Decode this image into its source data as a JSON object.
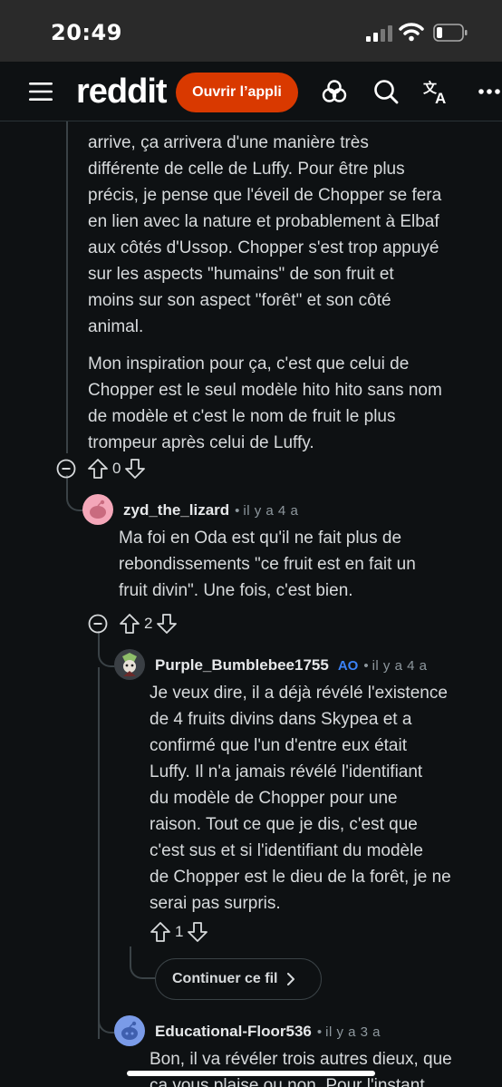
{
  "status_bar": {
    "time": "20:49"
  },
  "header": {
    "logo": "reddit",
    "open_app_label": "Ouvrir l’appli"
  },
  "comment_top": {
    "partial_line": "arrive, ça arrivera d'une manière très",
    "paragraph1_lines": [
      "différente de celle de Luffy. Pour être plus",
      "précis, je pense que l'éveil de Chopper se fera",
      "en lien avec la nature et probablement à Elbaf",
      "aux côtés d'Ussop. Chopper s'est trop appuyé",
      "sur les aspects \"humains\" de son fruit et",
      "moins sur son aspect \"forêt\" et son côté",
      "animal."
    ],
    "paragraph2_lines": [
      "Mon inspiration pour ça, c'est que celui de",
      "Chopper est le seul modèle hito hito sans nom",
      "de modèle et c'est le nom de fruit le plus",
      "trompeur après celui de Luffy."
    ],
    "score": "0"
  },
  "comment_zyd": {
    "username": "zyd_the_lizard",
    "dot": "•",
    "age": "il y a 4 a",
    "lines": [
      "Ma foi en Oda est qu'il ne fait plus de",
      "rebondissements \"ce fruit est en fait un",
      "fruit divin\". Une fois, c'est bien."
    ],
    "score": "2"
  },
  "comment_purple": {
    "username": "Purple_Bumblebee1755",
    "op_badge": "AO",
    "dot": "•",
    "age": "il y a 4 a",
    "lines": [
      "Je veux dire, il a déjà révélé l'existence",
      "de 4 fruits divins dans Skypea et a",
      "confirmé que l'un d'entre eux était",
      "Luffy. Il n'a jamais révélé l'identifiant",
      "du modèle de Chopper pour une",
      "raison. Tout ce que je dis, c'est que",
      "c'est sus et si l'identifiant du modèle",
      "de Chopper est le dieu de la forêt, je ne",
      "serai pas surpris."
    ],
    "score": "1"
  },
  "continue_thread": {
    "label": "Continuer ce fil"
  },
  "comment_educational": {
    "username": "Educational-Floor536",
    "dot": "•",
    "age": "il y a 3 a",
    "lines": [
      "Bon, il va révéler trois autres dieux, que",
      "ça vous plaise ou non. Pour l'instant"
    ]
  },
  "colors": {
    "accent": "#d93900",
    "op_badge": "#3b82f6",
    "background": "#0e1113"
  }
}
